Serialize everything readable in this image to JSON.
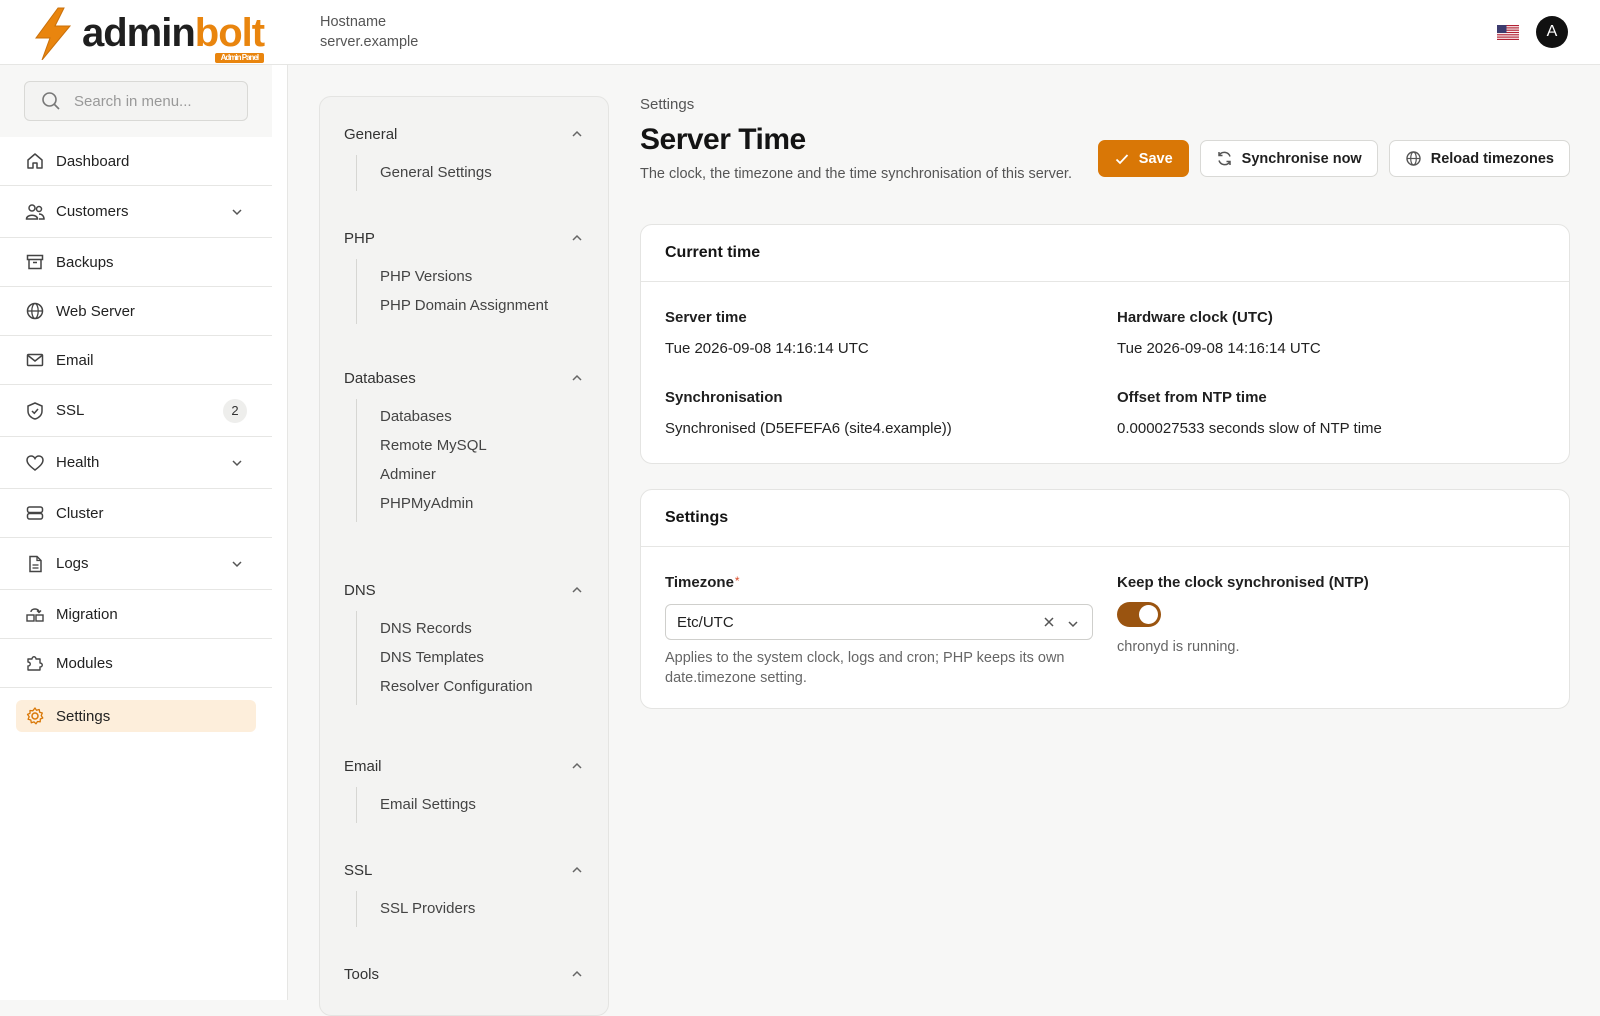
{
  "brand": {
    "name_part1": "admin",
    "name_part2": "bolt",
    "badge": "Admin Panel",
    "accent": "#e9850e"
  },
  "header": {
    "hostname_label": "Hostname",
    "hostname_value": "server.example",
    "avatar_initial": "A"
  },
  "sidebar": {
    "search_placeholder": "Search in menu...",
    "items": [
      {
        "label": "Dashboard"
      },
      {
        "label": "Customers"
      },
      {
        "label": "Backups"
      },
      {
        "label": "Web Server"
      },
      {
        "label": "Email"
      },
      {
        "label": "SSL",
        "badge": "2"
      },
      {
        "label": "Health"
      },
      {
        "label": "Cluster"
      },
      {
        "label": "Logs"
      },
      {
        "label": "Migration"
      },
      {
        "label": "Modules"
      },
      {
        "label": "Settings"
      }
    ]
  },
  "subnav": {
    "groups": [
      {
        "title": "General",
        "items": [
          "General Settings"
        ]
      },
      {
        "title": "PHP",
        "items": [
          "PHP Versions",
          "PHP Domain Assignment"
        ]
      },
      {
        "title": "Databases",
        "items": [
          "Databases",
          "Remote MySQL",
          "Adminer",
          "PHPMyAdmin"
        ]
      },
      {
        "title": "DNS",
        "items": [
          "DNS Records",
          "DNS Templates",
          "Resolver Configuration"
        ]
      },
      {
        "title": "Email",
        "items": [
          "Email Settings"
        ]
      },
      {
        "title": "SSL",
        "items": [
          "SSL Providers"
        ]
      },
      {
        "title": "Tools",
        "items": []
      }
    ]
  },
  "page": {
    "breadcrumb": "Settings",
    "title": "Server Time",
    "subtitle": "The clock, the timezone and the time synchronisation of this server.",
    "actions": {
      "save": "Save",
      "sync": "Synchronise now",
      "reload": "Reload timezones"
    }
  },
  "current_time": {
    "heading": "Current time",
    "server_time_label": "Server time",
    "server_time_value": "Tue 2026-09-08 14:16:14 UTC",
    "hw_clock_label": "Hardware clock (UTC)",
    "hw_clock_value": "Tue 2026-09-08 14:16:14 UTC",
    "sync_label": "Synchronisation",
    "sync_value": "Synchronised (D5EFEFA6 (site4.example))",
    "offset_label": "Offset from NTP time",
    "offset_value": "0.000027533 seconds slow of NTP time"
  },
  "settings": {
    "heading": "Settings",
    "timezone_label": "Timezone",
    "timezone_required": "*",
    "timezone_value": "Etc/UTC",
    "timezone_help": "Applies to the system clock, logs and cron; PHP keeps its own date.timezone setting.",
    "ntp_label": "Keep the clock synchronised (NTP)",
    "ntp_enabled": true,
    "ntp_note": "chronyd is running."
  }
}
